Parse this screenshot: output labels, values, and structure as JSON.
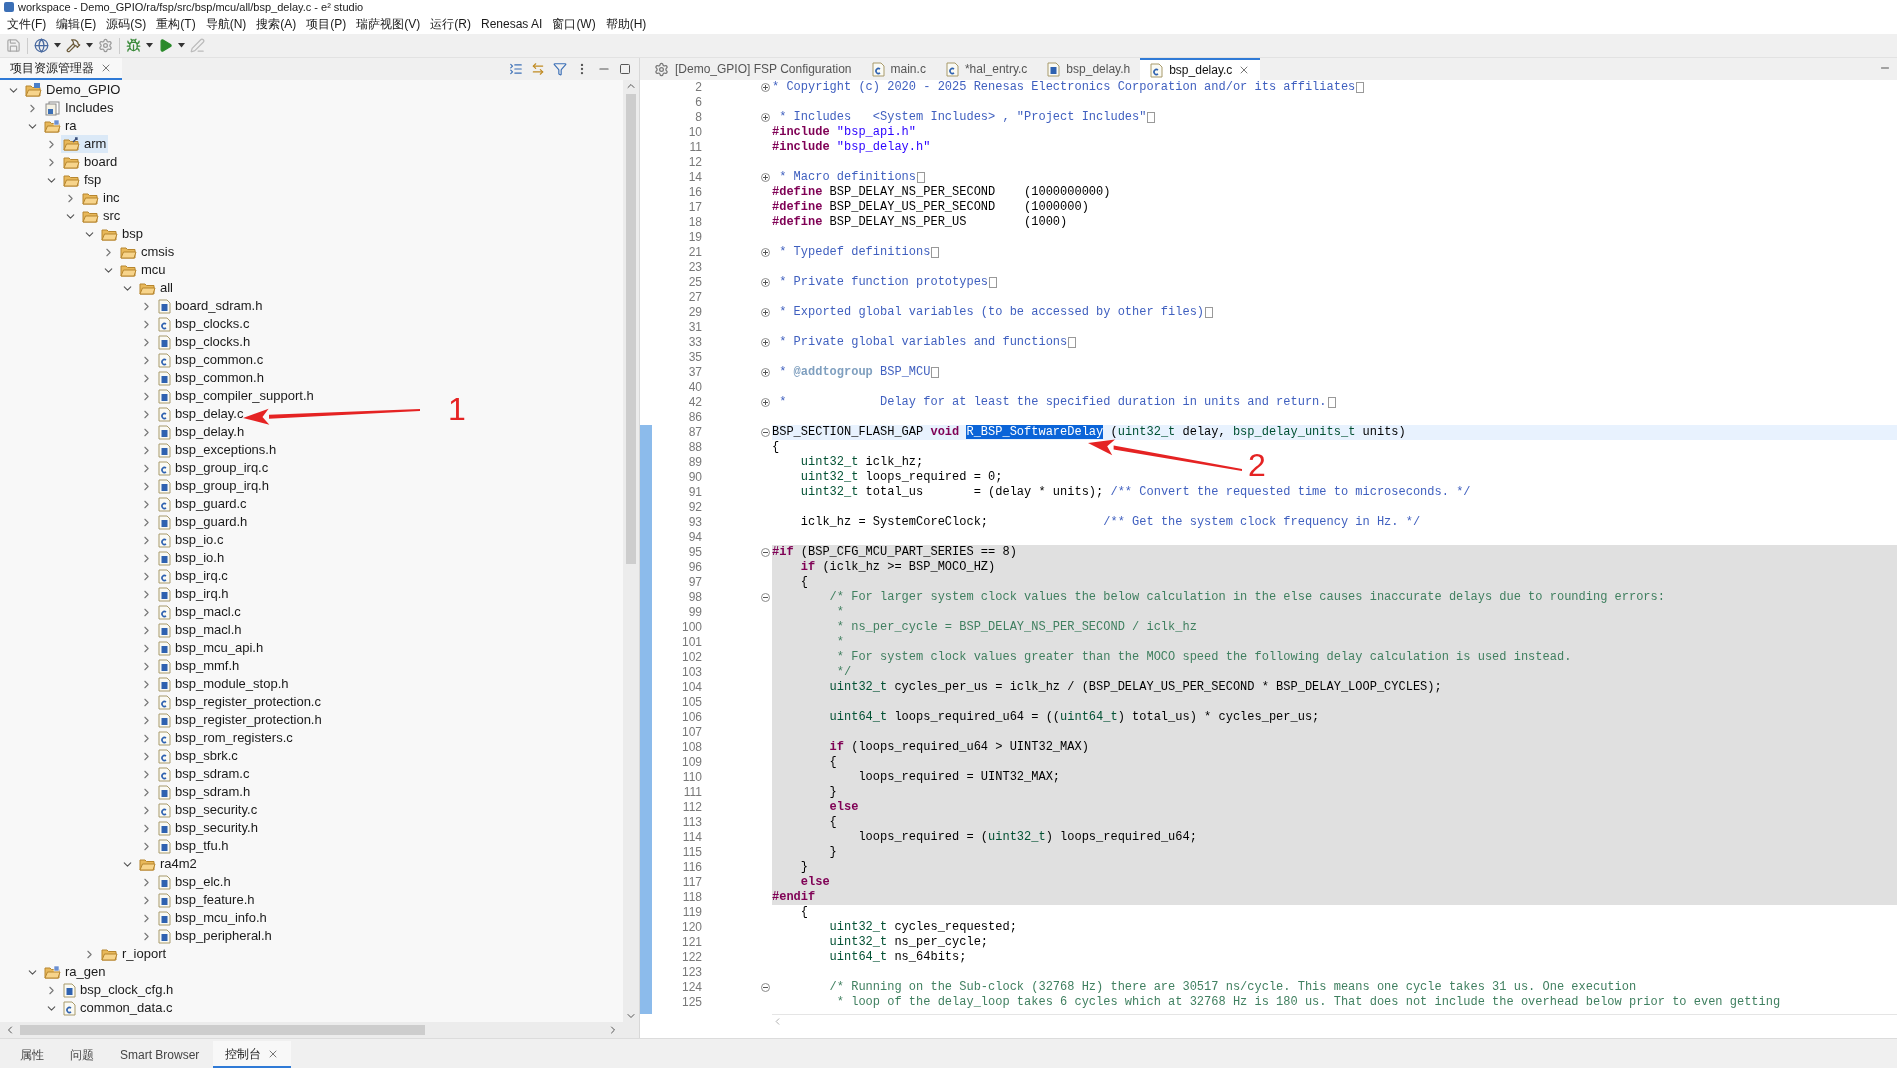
{
  "window": {
    "title": "workspace - Demo_GPIO/ra/fsp/src/bsp/mcu/all/bsp_delay.c - e² studio"
  },
  "menu": [
    "文件(F)",
    "编辑(E)",
    "源码(S)",
    "重构(T)",
    "导航(N)",
    "搜索(A)",
    "项目(P)",
    "瑞萨视图(V)",
    "运行(R)",
    "Renesas AI",
    "窗口(W)",
    "帮助(H)"
  ],
  "explorer": {
    "title": "项目资源管理器",
    "tree": [
      {
        "label": "Demo_GPIO",
        "kind": "project",
        "expanded": true,
        "selected": false,
        "children": [
          {
            "label": "Includes",
            "kind": "includes",
            "expanded": false,
            "selected": false
          },
          {
            "label": "ra",
            "kind": "source_folder",
            "expanded": true,
            "selected": false,
            "children": [
              {
                "label": "arm",
                "kind": "linked_folder",
                "expanded": false,
                "selected": true
              },
              {
                "label": "board",
                "kind": "folder",
                "expanded": false,
                "selected": false
              },
              {
                "label": "fsp",
                "kind": "folder",
                "expanded": true,
                "selected": false,
                "children": [
                  {
                    "label": "inc",
                    "kind": "folder",
                    "expanded": false,
                    "selected": false
                  },
                  {
                    "label": "src",
                    "kind": "folder",
                    "expanded": true,
                    "selected": false,
                    "children": [
                      {
                        "label": "bsp",
                        "kind": "folder",
                        "expanded": true,
                        "selected": false,
                        "children": [
                          {
                            "label": "cmsis",
                            "kind": "folder",
                            "expanded": false,
                            "selected": false
                          },
                          {
                            "label": "mcu",
                            "kind": "folder",
                            "expanded": true,
                            "selected": false,
                            "children": [
                              {
                                "label": "all",
                                "kind": "folder",
                                "expanded": true,
                                "selected": false,
                                "children": [
                                  {
                                    "label": "board_sdram.h",
                                    "kind": "h",
                                    "expanded": false,
                                    "selected": false
                                  },
                                  {
                                    "label": "bsp_clocks.c",
                                    "kind": "c",
                                    "expanded": false,
                                    "selected": false
                                  },
                                  {
                                    "label": "bsp_clocks.h",
                                    "kind": "h",
                                    "expanded": false,
                                    "selected": false
                                  },
                                  {
                                    "label": "bsp_common.c",
                                    "kind": "c",
                                    "expanded": false,
                                    "selected": false
                                  },
                                  {
                                    "label": "bsp_common.h",
                                    "kind": "h",
                                    "expanded": false,
                                    "selected": false
                                  },
                                  {
                                    "label": "bsp_compiler_support.h",
                                    "kind": "h",
                                    "expanded": false,
                                    "selected": false
                                  },
                                  {
                                    "label": "bsp_delay.c",
                                    "kind": "c",
                                    "expanded": false,
                                    "selected": false
                                  },
                                  {
                                    "label": "bsp_delay.h",
                                    "kind": "h",
                                    "expanded": false,
                                    "selected": false
                                  },
                                  {
                                    "label": "bsp_exceptions.h",
                                    "kind": "h",
                                    "expanded": false,
                                    "selected": false
                                  },
                                  {
                                    "label": "bsp_group_irq.c",
                                    "kind": "c",
                                    "expanded": false,
                                    "selected": false
                                  },
                                  {
                                    "label": "bsp_group_irq.h",
                                    "kind": "h",
                                    "expanded": false,
                                    "selected": false
                                  },
                                  {
                                    "label": "bsp_guard.c",
                                    "kind": "c",
                                    "expanded": false,
                                    "selected": false
                                  },
                                  {
                                    "label": "bsp_guard.h",
                                    "kind": "h",
                                    "expanded": false,
                                    "selected": false
                                  },
                                  {
                                    "label": "bsp_io.c",
                                    "kind": "c",
                                    "expanded": false,
                                    "selected": false
                                  },
                                  {
                                    "label": "bsp_io.h",
                                    "kind": "h",
                                    "expanded": false,
                                    "selected": false
                                  },
                                  {
                                    "label": "bsp_irq.c",
                                    "kind": "c",
                                    "expanded": false,
                                    "selected": false
                                  },
                                  {
                                    "label": "bsp_irq.h",
                                    "kind": "h",
                                    "expanded": false,
                                    "selected": false
                                  },
                                  {
                                    "label": "bsp_macl.c",
                                    "kind": "c",
                                    "expanded": false,
                                    "selected": false
                                  },
                                  {
                                    "label": "bsp_macl.h",
                                    "kind": "h",
                                    "expanded": false,
                                    "selected": false
                                  },
                                  {
                                    "label": "bsp_mcu_api.h",
                                    "kind": "h",
                                    "expanded": false,
                                    "selected": false
                                  },
                                  {
                                    "label": "bsp_mmf.h",
                                    "kind": "h",
                                    "expanded": false,
                                    "selected": false
                                  },
                                  {
                                    "label": "bsp_module_stop.h",
                                    "kind": "h",
                                    "expanded": false,
                                    "selected": false
                                  },
                                  {
                                    "label": "bsp_register_protection.c",
                                    "kind": "c",
                                    "expanded": false,
                                    "selected": false
                                  },
                                  {
                                    "label": "bsp_register_protection.h",
                                    "kind": "h",
                                    "expanded": false,
                                    "selected": false
                                  },
                                  {
                                    "label": "bsp_rom_registers.c",
                                    "kind": "c",
                                    "expanded": false,
                                    "selected": false
                                  },
                                  {
                                    "label": "bsp_sbrk.c",
                                    "kind": "c",
                                    "expanded": false,
                                    "selected": false
                                  },
                                  {
                                    "label": "bsp_sdram.c",
                                    "kind": "c",
                                    "expanded": false,
                                    "selected": false
                                  },
                                  {
                                    "label": "bsp_sdram.h",
                                    "kind": "h",
                                    "expanded": false,
                                    "selected": false
                                  },
                                  {
                                    "label": "bsp_security.c",
                                    "kind": "c",
                                    "expanded": false,
                                    "selected": false
                                  },
                                  {
                                    "label": "bsp_security.h",
                                    "kind": "h",
                                    "expanded": false,
                                    "selected": false
                                  },
                                  {
                                    "label": "bsp_tfu.h",
                                    "kind": "h",
                                    "expanded": false,
                                    "selected": false
                                  }
                                ]
                              },
                              {
                                "label": "ra4m2",
                                "kind": "folder",
                                "expanded": true,
                                "selected": false,
                                "children": [
                                  {
                                    "label": "bsp_elc.h",
                                    "kind": "h",
                                    "expanded": false,
                                    "selected": false
                                  },
                                  {
                                    "label": "bsp_feature.h",
                                    "kind": "h",
                                    "expanded": false,
                                    "selected": false
                                  },
                                  {
                                    "label": "bsp_mcu_info.h",
                                    "kind": "h",
                                    "expanded": false,
                                    "selected": false
                                  },
                                  {
                                    "label": "bsp_peripheral.h",
                                    "kind": "h",
                                    "expanded": false,
                                    "selected": false
                                  }
                                ]
                              }
                            ]
                          }
                        ]
                      },
                      {
                        "label": "r_ioport",
                        "kind": "folder",
                        "expanded": false,
                        "selected": false
                      }
                    ]
                  }
                ]
              }
            ]
          },
          {
            "label": "ra_gen",
            "kind": "source_folder",
            "expanded": true,
            "selected": false,
            "children": [
              {
                "label": "bsp_clock_cfg.h",
                "kind": "h",
                "expanded": false,
                "selected": false
              },
              {
                "label": "common_data.c",
                "kind": "c",
                "expanded": true,
                "selected": false
              }
            ]
          }
        ]
      }
    ]
  },
  "editor": {
    "tabs": [
      {
        "label": "[Demo_GPIO] FSP Configuration",
        "kind": "config",
        "selected": false
      },
      {
        "label": "main.c",
        "kind": "c",
        "selected": false
      },
      {
        "label": "*hal_entry.c",
        "kind": "c",
        "selected": false
      },
      {
        "label": "bsp_delay.h",
        "kind": "h",
        "selected": false
      },
      {
        "label": "bsp_delay.c",
        "kind": "c",
        "selected": true
      }
    ],
    "lines": [
      {
        "num": "2",
        "kind": "normal",
        "collapsed": true,
        "tokens": [
          {
            "kind": "doc",
            "text": "* Copyright (c) 2020 - 2025 Renesas Electronics Corporation and/or its affiliates"
          }
        ]
      },
      {
        "num": "6",
        "kind": "normal"
      },
      {
        "num": "8",
        "kind": "normal",
        "collapsed": true,
        "tokens": [
          {
            "kind": "doc",
            "text": " * Includes   <System Includes> , \"Project Includes\""
          }
        ]
      },
      {
        "num": "10",
        "kind": "normal",
        "tokens": [
          {
            "kind": "kw",
            "text": "#include "
          },
          {
            "kind": "str",
            "text": "\"bsp_api.h\""
          }
        ]
      },
      {
        "num": "11",
        "kind": "normal",
        "tokens": [
          {
            "kind": "kw",
            "text": "#include "
          },
          {
            "kind": "str",
            "text": "\"bsp_delay.h\""
          }
        ]
      },
      {
        "num": "12",
        "kind": "normal"
      },
      {
        "num": "14",
        "kind": "normal",
        "collapsed": true,
        "tokens": [
          {
            "kind": "doc",
            "text": " * Macro definitions"
          }
        ]
      },
      {
        "num": "16",
        "kind": "normal",
        "tokens": [
          {
            "kind": "kw",
            "text": "#define "
          },
          {
            "kind": "plain",
            "text": "BSP_DELAY_NS_PER_SECOND    (1000000000)"
          }
        ]
      },
      {
        "num": "17",
        "kind": "normal",
        "tokens": [
          {
            "kind": "kw",
            "text": "#define "
          },
          {
            "kind": "plain",
            "text": "BSP_DELAY_US_PER_SECOND    (1000000)"
          }
        ]
      },
      {
        "num": "18",
        "kind": "normal",
        "tokens": [
          {
            "kind": "kw",
            "text": "#define "
          },
          {
            "kind": "plain",
            "text": "BSP_DELAY_NS_PER_US        (1000)"
          }
        ]
      },
      {
        "num": "19",
        "kind": "normal"
      },
      {
        "num": "21",
        "kind": "normal",
        "collapsed": true,
        "tokens": [
          {
            "kind": "doc",
            "text": " * Typedef definitions"
          }
        ]
      },
      {
        "num": "23",
        "kind": "normal"
      },
      {
        "num": "25",
        "kind": "normal",
        "collapsed": true,
        "tokens": [
          {
            "kind": "doc",
            "text": " * Private function prototypes"
          }
        ]
      },
      {
        "num": "27",
        "kind": "normal"
      },
      {
        "num": "29",
        "kind": "normal",
        "collapsed": true,
        "tokens": [
          {
            "kind": "doc",
            "text": " * Exported global variables (to be accessed by other files)"
          }
        ]
      },
      {
        "num": "31",
        "kind": "normal"
      },
      {
        "num": "33",
        "kind": "normal",
        "collapsed": true,
        "tokens": [
          {
            "kind": "doc",
            "text": " * Private global variables and functions"
          }
        ]
      },
      {
        "num": "35",
        "kind": "normal"
      },
      {
        "num": "37",
        "kind": "normal",
        "collapsed": true,
        "tokens": [
          {
            "kind": "doc",
            "text": " * "
          },
          {
            "kind": "tag",
            "text": "@addtogroup"
          },
          {
            "kind": "doc",
            "text": " BSP_MCU"
          }
        ]
      },
      {
        "num": "40",
        "kind": "normal"
      },
      {
        "num": "42",
        "kind": "normal",
        "collapsed": true,
        "tokens": [
          {
            "kind": "doc",
            "text": " *             Delay for at least the specified duration in units and return."
          }
        ]
      },
      {
        "num": "86",
        "kind": "normal"
      },
      {
        "num": "87",
        "kind": "current",
        "collapsed": false,
        "tokens": [
          {
            "kind": "plain",
            "text": "BSP_SECTION_FLASH_GAP "
          },
          {
            "kind": "kw",
            "text": "void "
          },
          {
            "kind": "sel",
            "text": "R_BSP_SoftwareDelay"
          },
          {
            "kind": "plain",
            "text": " ("
          },
          {
            "kind": "ty",
            "text": "uint32_t"
          },
          {
            "kind": "plain",
            "text": " delay, "
          },
          {
            "kind": "ty",
            "text": "bsp_delay_units_t"
          },
          {
            "kind": "plain",
            "text": " units)"
          }
        ]
      },
      {
        "num": "88",
        "kind": "normal",
        "tokens": [
          {
            "kind": "plain",
            "text": "{"
          }
        ]
      },
      {
        "num": "89",
        "kind": "normal",
        "tokens": [
          {
            "kind": "ty",
            "text": "    uint32_t"
          },
          {
            "kind": "plain",
            "text": " iclk_hz;"
          }
        ]
      },
      {
        "num": "90",
        "kind": "normal",
        "tokens": [
          {
            "kind": "ty",
            "text": "    uint32_t"
          },
          {
            "kind": "plain",
            "text": " loops_required = 0;"
          }
        ]
      },
      {
        "num": "91",
        "kind": "normal",
        "tokens": [
          {
            "kind": "ty",
            "text": "    uint32_t"
          },
          {
            "kind": "plain",
            "text": " total_us       = (delay * units); "
          },
          {
            "kind": "doc",
            "text": "/** Convert the requested time to microseconds. */"
          }
        ]
      },
      {
        "num": "92",
        "kind": "normal"
      },
      {
        "num": "93",
        "kind": "normal",
        "tokens": [
          {
            "kind": "plain",
            "text": "    iclk_hz = SystemCoreClock;                "
          },
          {
            "kind": "doc",
            "text": "/** Get the system clock frequency in Hz. */"
          }
        ]
      },
      {
        "num": "94",
        "kind": "normal"
      },
      {
        "num": "95",
        "kind": "inactive",
        "collapsed": false,
        "tokens": [
          {
            "kind": "kw",
            "text": "#if"
          },
          {
            "kind": "plain",
            "text": " (BSP_CFG_MCU_PART_SERIES == 8)"
          }
        ]
      },
      {
        "num": "96",
        "kind": "inactive",
        "tokens": [
          {
            "kind": "kw",
            "text": "    if"
          },
          {
            "kind": "plain",
            "text": " (iclk_hz >= BSP_MOCO_HZ)"
          }
        ]
      },
      {
        "num": "97",
        "kind": "inactive",
        "tokens": [
          {
            "kind": "plain",
            "text": "    {"
          }
        ]
      },
      {
        "num": "98",
        "kind": "inactive",
        "collapsed": false,
        "tokens": [
          {
            "kind": "com",
            "text": "        /* For larger system clock values the below calculation in the else causes inaccurate delays due to rounding errors:"
          }
        ]
      },
      {
        "num": "99",
        "kind": "inactive",
        "tokens": [
          {
            "kind": "com",
            "text": "         *"
          }
        ]
      },
      {
        "num": "100",
        "kind": "inactive",
        "tokens": [
          {
            "kind": "com",
            "text": "         * ns_per_cycle = BSP_DELAY_NS_PER_SECOND / iclk_hz"
          }
        ]
      },
      {
        "num": "101",
        "kind": "inactive",
        "tokens": [
          {
            "kind": "com",
            "text": "         *"
          }
        ]
      },
      {
        "num": "102",
        "kind": "inactive",
        "tokens": [
          {
            "kind": "com",
            "text": "         * For system clock values greater than the MOCO speed the following delay calculation is used instead."
          }
        ]
      },
      {
        "num": "103",
        "kind": "inactive",
        "tokens": [
          {
            "kind": "com",
            "text": "         */"
          }
        ]
      },
      {
        "num": "104",
        "kind": "inactive",
        "tokens": [
          {
            "kind": "ty",
            "text": "        uint32_t"
          },
          {
            "kind": "plain",
            "text": " cycles_per_us = iclk_hz / (BSP_DELAY_US_PER_SECOND * BSP_DELAY_LOOP_CYCLES);"
          }
        ]
      },
      {
        "num": "105",
        "kind": "inactive"
      },
      {
        "num": "106",
        "kind": "inactive",
        "tokens": [
          {
            "kind": "ty",
            "text": "        uint64_t"
          },
          {
            "kind": "plain",
            "text": " loops_required_u64 = (("
          },
          {
            "kind": "ty",
            "text": "uint64_t"
          },
          {
            "kind": "plain",
            "text": ") total_us) * cycles_per_us;"
          }
        ]
      },
      {
        "num": "107",
        "kind": "inactive"
      },
      {
        "num": "108",
        "kind": "inactive",
        "tokens": [
          {
            "kind": "kw",
            "text": "        if"
          },
          {
            "kind": "plain",
            "text": " (loops_required_u64 > UINT32_MAX)"
          }
        ]
      },
      {
        "num": "109",
        "kind": "inactive",
        "tokens": [
          {
            "kind": "plain",
            "text": "        {"
          }
        ]
      },
      {
        "num": "110",
        "kind": "inactive",
        "tokens": [
          {
            "kind": "plain",
            "text": "            loops_required = UINT32_MAX;"
          }
        ]
      },
      {
        "num": "111",
        "kind": "inactive",
        "tokens": [
          {
            "kind": "plain",
            "text": "        }"
          }
        ]
      },
      {
        "num": "112",
        "kind": "inactive",
        "tokens": [
          {
            "kind": "kw",
            "text": "        else"
          }
        ]
      },
      {
        "num": "113",
        "kind": "inactive",
        "tokens": [
          {
            "kind": "plain",
            "text": "        {"
          }
        ]
      },
      {
        "num": "114",
        "kind": "inactive",
        "tokens": [
          {
            "kind": "plain",
            "text": "            loops_required = ("
          },
          {
            "kind": "ty",
            "text": "uint32_t"
          },
          {
            "kind": "plain",
            "text": ") loops_required_u64;"
          }
        ]
      },
      {
        "num": "115",
        "kind": "inactive",
        "tokens": [
          {
            "kind": "plain",
            "text": "        }"
          }
        ]
      },
      {
        "num": "116",
        "kind": "inactive",
        "tokens": [
          {
            "kind": "plain",
            "text": "    }"
          }
        ]
      },
      {
        "num": "117",
        "kind": "inactive",
        "tokens": [
          {
            "kind": "kw",
            "text": "    else"
          }
        ]
      },
      {
        "num": "118",
        "kind": "inactive",
        "tokens": [
          {
            "kind": "kw",
            "text": "#endif"
          }
        ]
      },
      {
        "num": "119",
        "kind": "normal",
        "tokens": [
          {
            "kind": "plain",
            "text": "    {"
          }
        ]
      },
      {
        "num": "120",
        "kind": "normal",
        "tokens": [
          {
            "kind": "ty",
            "text": "        uint32_t"
          },
          {
            "kind": "plain",
            "text": " cycles_requested;"
          }
        ]
      },
      {
        "num": "121",
        "kind": "normal",
        "tokens": [
          {
            "kind": "ty",
            "text": "        uint32_t"
          },
          {
            "kind": "plain",
            "text": " ns_per_cycle;"
          }
        ]
      },
      {
        "num": "122",
        "kind": "normal",
        "tokens": [
          {
            "kind": "ty",
            "text": "        uint64_t"
          },
          {
            "kind": "plain",
            "text": " ns_64bits;"
          }
        ]
      },
      {
        "num": "123",
        "kind": "normal"
      },
      {
        "num": "124",
        "kind": "normal",
        "collapsed": false,
        "tokens": [
          {
            "kind": "com",
            "text": "        /* Running on the Sub-clock (32768 Hz) there are 30517 ns/cycle. This means one cycle takes 31 us. One execution"
          }
        ]
      },
      {
        "num": "125",
        "kind": "normal",
        "tokens": [
          {
            "kind": "com",
            "text": "         * loop of the delay_loop takes 6 cycles which at 32768 Hz is 180 us. That does not include the overhead below prior to even getting"
          }
        ]
      }
    ]
  },
  "bottom_tabs": [
    {
      "label": "属性",
      "selected": false,
      "closable": false
    },
    {
      "label": "问题",
      "selected": false,
      "closable": false
    },
    {
      "label": "Smart Browser",
      "selected": false,
      "closable": false
    },
    {
      "label": "控制台",
      "selected": true,
      "closable": true
    }
  ],
  "annotations": [
    {
      "label": "1"
    },
    {
      "label": "2"
    }
  ]
}
